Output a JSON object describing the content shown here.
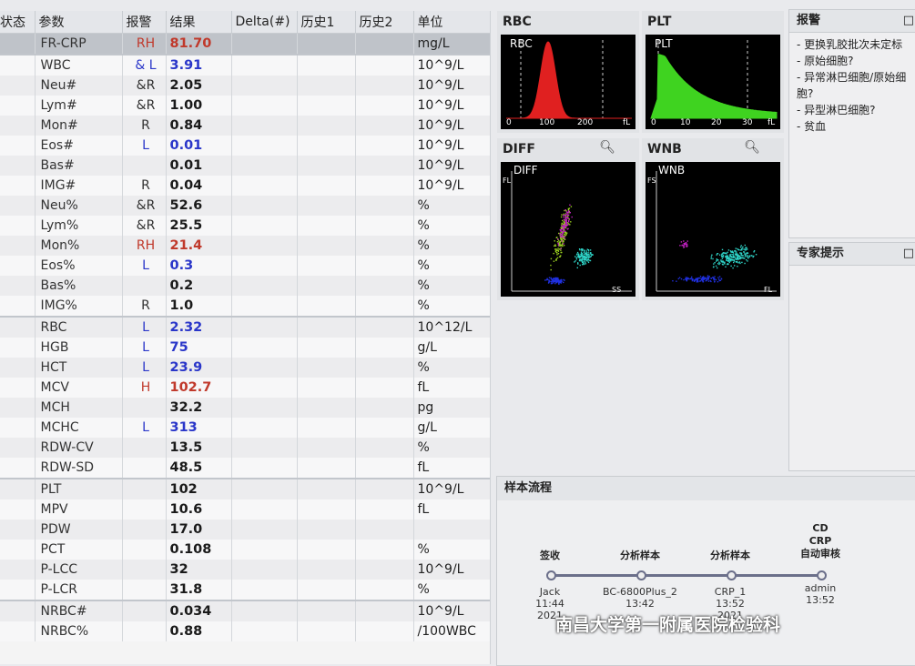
{
  "table": {
    "headers": [
      "状态",
      "参数",
      "报警",
      "结果",
      "Delta(#)",
      "历史1",
      "历史2",
      "单位"
    ],
    "rows": [
      {
        "param": "FR-CRP",
        "flag": "RH",
        "result": "81.70",
        "unit": "mg/L",
        "fc": "H",
        "vc": "H"
      },
      {
        "param": "WBC",
        "flag": "&  L",
        "result": "3.91",
        "unit": "10^9/L",
        "fc": "L",
        "vc": "L"
      },
      {
        "param": "Neu#",
        "flag": "&R",
        "result": "2.05",
        "unit": "10^9/L",
        "fc": "N",
        "vc": "N"
      },
      {
        "param": "Lym#",
        "flag": "&R",
        "result": "1.00",
        "unit": "10^9/L",
        "fc": "N",
        "vc": "N"
      },
      {
        "param": "Mon#",
        "flag": "R",
        "result": "0.84",
        "unit": "10^9/L",
        "fc": "N",
        "vc": "N"
      },
      {
        "param": "Eos#",
        "flag": "L",
        "result": "0.01",
        "unit": "10^9/L",
        "fc": "L",
        "vc": "L"
      },
      {
        "param": "Bas#",
        "flag": "",
        "result": "0.01",
        "unit": "10^9/L",
        "fc": "N",
        "vc": "N"
      },
      {
        "param": "IMG#",
        "flag": "R",
        "result": "0.04",
        "unit": "10^9/L",
        "fc": "N",
        "vc": "N"
      },
      {
        "param": "Neu%",
        "flag": "&R",
        "result": "52.6",
        "unit": "%",
        "fc": "N",
        "vc": "N"
      },
      {
        "param": "Lym%",
        "flag": "&R",
        "result": "25.5",
        "unit": "%",
        "fc": "N",
        "vc": "N"
      },
      {
        "param": "Mon%",
        "flag": "RH",
        "result": "21.4",
        "unit": "%",
        "fc": "H",
        "vc": "H"
      },
      {
        "param": "Eos%",
        "flag": "L",
        "result": "0.3",
        "unit": "%",
        "fc": "L",
        "vc": "L"
      },
      {
        "param": "Bas%",
        "flag": "",
        "result": "0.2",
        "unit": "%",
        "fc": "N",
        "vc": "N"
      },
      {
        "param": "IMG%",
        "flag": "R",
        "result": "1.0",
        "unit": "%",
        "fc": "N",
        "vc": "N"
      },
      {
        "param": "RBC",
        "flag": "L",
        "result": "2.32",
        "unit": "10^12/L",
        "fc": "L",
        "vc": "L"
      },
      {
        "param": "HGB",
        "flag": "L",
        "result": "75",
        "unit": "g/L",
        "fc": "L",
        "vc": "L"
      },
      {
        "param": "HCT",
        "flag": "L",
        "result": "23.9",
        "unit": "%",
        "fc": "L",
        "vc": "L"
      },
      {
        "param": "MCV",
        "flag": "H",
        "result": "102.7",
        "unit": "fL",
        "fc": "H",
        "vc": "H"
      },
      {
        "param": "MCH",
        "flag": "",
        "result": "32.2",
        "unit": "pg",
        "fc": "N",
        "vc": "N"
      },
      {
        "param": "MCHC",
        "flag": "L",
        "result": "313",
        "unit": "g/L",
        "fc": "L",
        "vc": "L"
      },
      {
        "param": "RDW-CV",
        "flag": "",
        "result": "13.5",
        "unit": "%",
        "fc": "N",
        "vc": "N"
      },
      {
        "param": "RDW-SD",
        "flag": "",
        "result": "48.5",
        "unit": "fL",
        "fc": "N",
        "vc": "N"
      },
      {
        "param": "PLT",
        "flag": "",
        "result": "102",
        "unit": "10^9/L",
        "fc": "N",
        "vc": "N"
      },
      {
        "param": "MPV",
        "flag": "",
        "result": "10.6",
        "unit": "fL",
        "fc": "N",
        "vc": "N"
      },
      {
        "param": "PDW",
        "flag": "",
        "result": "17.0",
        "unit": "",
        "fc": "N",
        "vc": "N"
      },
      {
        "param": "PCT",
        "flag": "",
        "result": "0.108",
        "unit": "%",
        "fc": "N",
        "vc": "N"
      },
      {
        "param": "P-LCC",
        "flag": "",
        "result": "32",
        "unit": "10^9/L",
        "fc": "N",
        "vc": "N"
      },
      {
        "param": "P-LCR",
        "flag": "",
        "result": "31.8",
        "unit": "%",
        "fc": "N",
        "vc": "N"
      },
      {
        "param": "NRBC#",
        "flag": "",
        "result": "0.034",
        "unit": "10^9/L",
        "fc": "N",
        "vc": "N"
      },
      {
        "param": "NRBC%",
        "flag": "",
        "result": "0.88",
        "unit": "/100WBC",
        "fc": "N",
        "vc": "N"
      }
    ]
  },
  "colors": {
    "high": "#c0392b",
    "low": "#2a36c9",
    "rbc_curve": "#e02020",
    "plt_curve": "#3fd320",
    "diff_neu": "#2fd4c8",
    "diff_lym": "#9bd020",
    "diff_eos": "#c020c0",
    "diff_nrbc": "#2030e0"
  },
  "histograms": {
    "rbc": {
      "title": "RBC",
      "label": "RBC",
      "ticks": [
        "0",
        "100",
        "200",
        "fL"
      ]
    },
    "plt": {
      "title": "PLT",
      "label": "PLT",
      "ticks": [
        "0",
        "10",
        "20",
        "30",
        "fL"
      ]
    }
  },
  "scatters": {
    "diff": {
      "title": "DIFF",
      "label": "DIFF",
      "yaxis": "FL",
      "xaxis": "SS",
      "icon": "zoom-icon"
    },
    "wnb": {
      "title": "WNB",
      "label": "WNB",
      "yaxis": "FS",
      "xaxis": "FL",
      "icon": "zoom-icon"
    }
  },
  "alarm": {
    "title": "报警",
    "items": [
      "- 更换乳胶批次未定标",
      "- 原始细胞?",
      "- 异常淋巴细胞/原始细胞?",
      "- 异型淋巴细胞?",
      "- 贫血"
    ]
  },
  "expert": {
    "title": "专家提示"
  },
  "flow": {
    "title": "样本流程",
    "stages": [
      {
        "label": "签收",
        "user": "Jack",
        "time": "11:44",
        "date": "2021"
      },
      {
        "label": "分析样本",
        "user": "BC-6800Plus_2",
        "time": "13:42",
        "date": ""
      },
      {
        "label": "分析样本",
        "user": "CRP_1",
        "time": "13:52",
        "date": "2021"
      },
      {
        "label": "CD CRP 自动审核",
        "user": "admin",
        "time": "13:52",
        "date": ""
      }
    ]
  },
  "watermark": "南昌大学第一附属医院检验科"
}
